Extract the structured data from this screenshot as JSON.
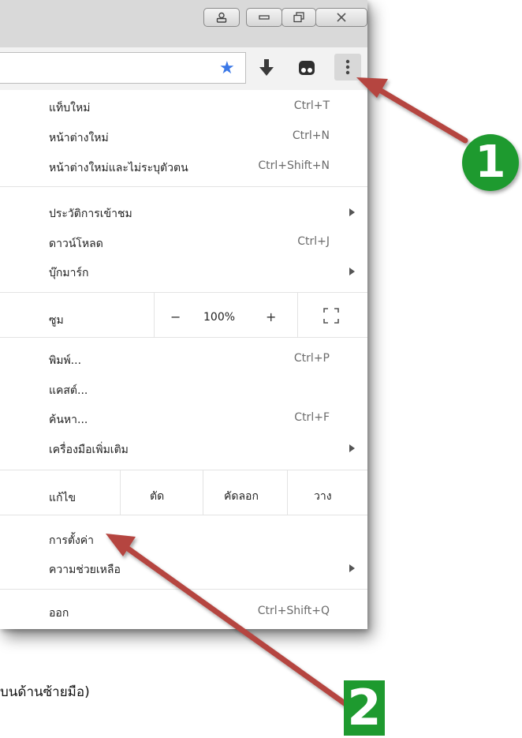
{
  "window_controls": {
    "profile_icon": "person-icon",
    "minimize_icon": "minimize-icon",
    "restore_icon": "restore-icon",
    "close_icon": "close-icon"
  },
  "toolbar": {
    "bookmark_star_icon": "star-icon",
    "download_icon": "download-arrow-icon",
    "extension_icon": "extension-icon",
    "menu_icon": "kebab-menu-icon",
    "star_color": "#3b78e7"
  },
  "menu": {
    "new_tab": {
      "label": "แท็บใหม่",
      "shortcut": "Ctrl+T"
    },
    "new_window": {
      "label": "หน้าต่างใหม่",
      "shortcut": "Ctrl+N"
    },
    "incognito": {
      "label": "หน้าต่างใหม่และไม่ระบุตัวตน",
      "shortcut": "Ctrl+Shift+N"
    },
    "history": {
      "label": "ประวัติการเข้าชม"
    },
    "downloads": {
      "label": "ดาวน์โหลด",
      "shortcut": "Ctrl+J"
    },
    "bookmarks": {
      "label": "บุ๊กมาร์ก"
    },
    "zoom": {
      "label": "ซูม",
      "minus": "−",
      "value": "100%",
      "plus": "+"
    },
    "print": {
      "label": "พิมพ์...",
      "shortcut": "Ctrl+P"
    },
    "cast": {
      "label": "แคสต์..."
    },
    "find": {
      "label": "ค้นหา...",
      "shortcut": "Ctrl+F"
    },
    "more_tools": {
      "label": "เครื่องมือเพิ่มเติม"
    },
    "edit": {
      "label": "แก้ไข",
      "cut": "ตัด",
      "copy": "คัดลอก",
      "paste": "วาง"
    },
    "settings": {
      "label": "การตั้งค่า"
    },
    "help": {
      "label": "ความช่วยเหลือ"
    },
    "exit": {
      "label": "ออก",
      "shortcut": "Ctrl+Shift+Q"
    }
  },
  "annotations": {
    "step1": "1",
    "step2": "2",
    "arrow_color": "#b5443f",
    "badge1_color": "#1e9a2f",
    "badge2_color": "#1e9a2f"
  },
  "caption": "บนด้านซ้ายมือ)"
}
